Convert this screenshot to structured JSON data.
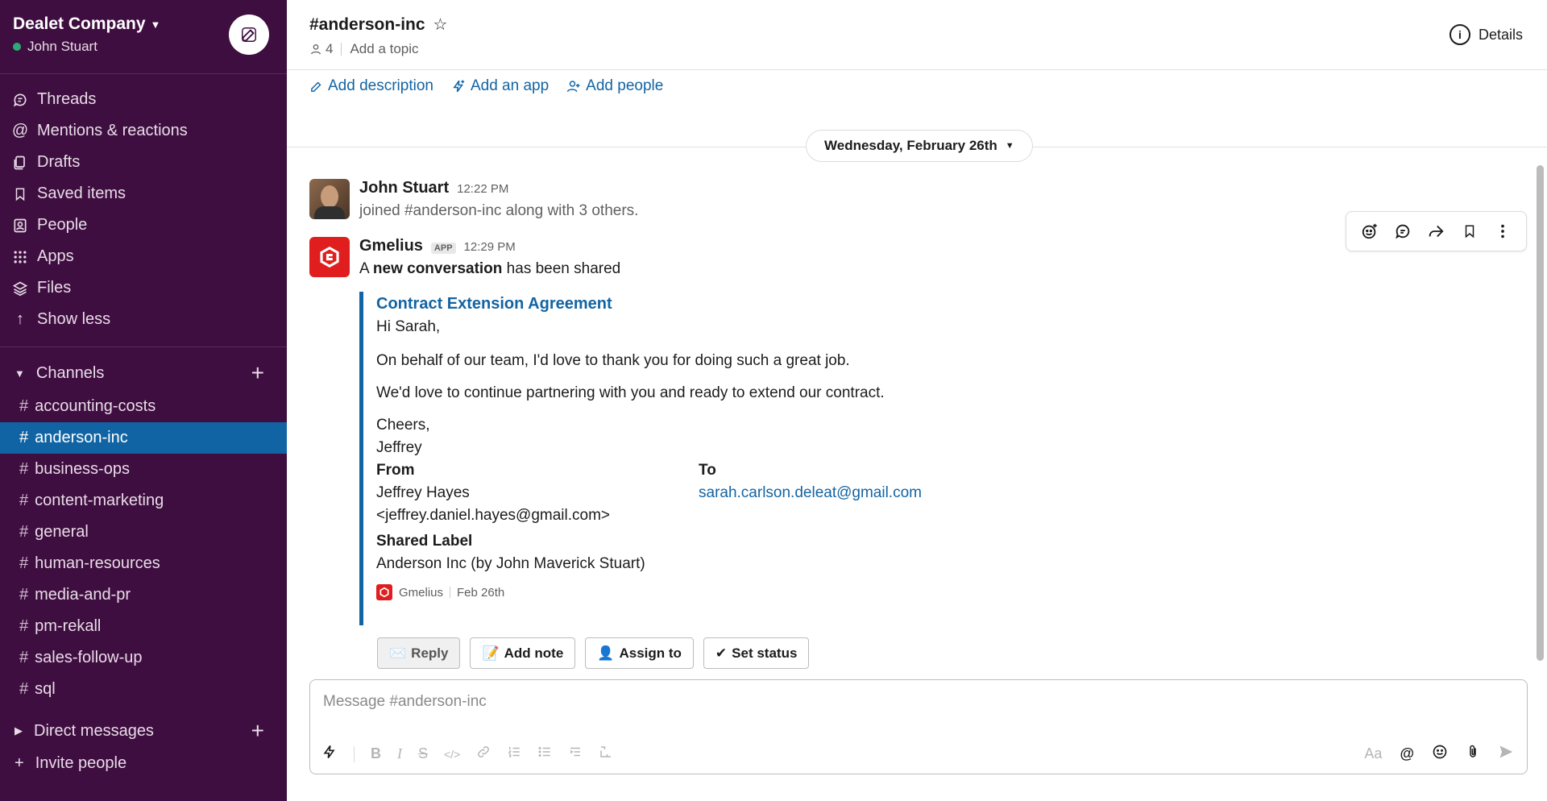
{
  "workspace": {
    "name": "Dealet Company",
    "user": "John Stuart"
  },
  "nav": [
    {
      "label": "Threads",
      "icon": "threads-icon"
    },
    {
      "label": "Mentions & reactions",
      "icon": "at-icon"
    },
    {
      "label": "Drafts",
      "icon": "drafts-icon"
    },
    {
      "label": "Saved items",
      "icon": "bookmark-icon"
    },
    {
      "label": "People",
      "icon": "people-icon"
    },
    {
      "label": "Apps",
      "icon": "apps-grid-icon"
    },
    {
      "label": "Files",
      "icon": "files-layers-icon"
    },
    {
      "label": "Show less",
      "icon": "arrow-up-icon"
    }
  ],
  "channels_section": {
    "label": "Channels"
  },
  "channels": [
    "accounting-costs",
    "anderson-inc",
    "business-ops",
    "content-marketing",
    "general",
    "human-resources",
    "media-and-pr",
    "pm-rekall",
    "sales-follow-up",
    "sql"
  ],
  "active_channel": "anderson-inc",
  "dm_section": {
    "label": "Direct messages"
  },
  "invite": {
    "label": "Invite people"
  },
  "channel_header": {
    "title": "#anderson-inc",
    "member_count": "4",
    "topic": "Add a topic",
    "details": "Details"
  },
  "bookmarks": {
    "add_description": "Add description",
    "add_app": "Add an app",
    "add_people": "Add people"
  },
  "date_divider": "Wednesday, February 26th",
  "messages": [
    {
      "author": "John Stuart",
      "time": "12:22 PM",
      "text": "joined #anderson-inc along with 3 others."
    },
    {
      "author": "Gmelius",
      "badge": "APP",
      "time": "12:29 PM",
      "text_prefix": "A ",
      "text_bold": "new conversation",
      "text_suffix": " has been shared"
    }
  ],
  "attachment": {
    "title": "Contract Extension Agreement",
    "greeting": "Hi Sarah,",
    "para1": "On behalf of our team, I'd love to thank you for doing such a great job.",
    "para2": "We'd love to continue partnering with you and ready to extend our contract.",
    "closing": "Cheers,",
    "signature": "Jeffrey",
    "from_label": "From",
    "to_label": "To",
    "from_name": "Jeffrey Hayes",
    "from_email": "<jeffrey.daniel.hayes@gmail.com>",
    "to_email": "sarah.carlson.deleat@gmail.com",
    "shared_label_title": "Shared Label",
    "shared_label_value": "Anderson Inc (by John Maverick Stuart)",
    "footer_source": "Gmelius",
    "footer_date": "Feb 26th"
  },
  "actions": [
    {
      "label": "Reply",
      "emoji": "✉️"
    },
    {
      "label": "Add note",
      "emoji": "📝"
    },
    {
      "label": "Assign to",
      "emoji": "👤"
    },
    {
      "label": "Set status",
      "emoji": "✔"
    }
  ],
  "composer": {
    "placeholder": "Message #anderson-inc"
  },
  "colors": {
    "sidebar": "#3f0e40",
    "active": "#1164a3",
    "link": "#1264a3",
    "gmelius": "#e01e1e"
  }
}
